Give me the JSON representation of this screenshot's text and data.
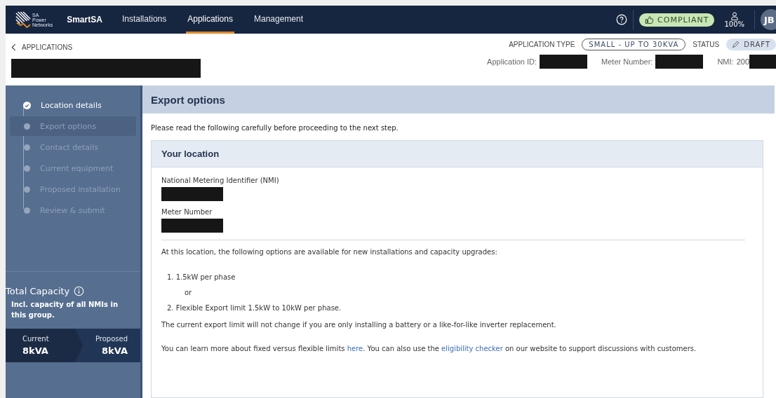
{
  "nav": {
    "logo_lines": [
      "SA",
      "Power",
      "Networks"
    ],
    "brand": "SmartSA",
    "tabs": [
      {
        "label": "Installations",
        "selected": false
      },
      {
        "label": "Applications",
        "selected": true
      },
      {
        "label": "Management",
        "selected": false
      }
    ],
    "compliance": "COMPLIANT",
    "zoom": "100%",
    "avatar": "JB"
  },
  "header": {
    "back": "APPLICATIONS",
    "type_label": "APPLICATION TYPE",
    "type_value": "SMALL - UP TO 30KVA",
    "status_label": "STATUS",
    "status_value": "DRAFT",
    "ids": [
      {
        "label": "Application ID:"
      },
      {
        "label": "Meter Number:"
      },
      {
        "label": "NMI:",
        "value": "200"
      }
    ]
  },
  "sidebar": {
    "steps": [
      {
        "label": "Location details",
        "completed": true,
        "selected": false
      },
      {
        "label": "Export options",
        "completed": false,
        "selected": true
      },
      {
        "label": "Contact details",
        "completed": false,
        "selected": false
      },
      {
        "label": "Current equipment",
        "completed": false,
        "selected": false
      },
      {
        "label": "Proposed installation",
        "completed": false,
        "selected": false
      },
      {
        "label": "Review & submit",
        "completed": false,
        "selected": false
      }
    ],
    "capacity": {
      "title": "Total Capacity",
      "note": "Incl. capacity of all NMIs in this group.",
      "current_label": "Current",
      "current_value": "8kVA",
      "proposed_label": "Proposed",
      "proposed_value": "8kVA"
    }
  },
  "content": {
    "title": "Export options",
    "intro": "Please read the following carefully before proceeding to the next step.",
    "card": {
      "title": "Your location",
      "fields": [
        {
          "label": "National Metering Identifier (NMI)"
        },
        {
          "label": "Meter Number"
        }
      ],
      "options_intro": "At this location, the following options are available for new installations and capacity upgrades:",
      "options": [
        "1. 1.5kW per phase",
        "2. Flexible Export limit 1.5kW to 10kW per phase."
      ],
      "separator": "or",
      "note": "The current export limit will not change if you are only installing a battery or a like-for-like inverter replacement.",
      "learn_more": [
        {
          "kind": "text",
          "text": "You can learn more about fixed versus flexible limits "
        },
        {
          "kind": "link",
          "text": "here"
        },
        {
          "kind": "text",
          "text": ". You can also use the "
        },
        {
          "kind": "link",
          "text": "eligibility checker"
        },
        {
          "kind": "text",
          "text": " on our website to support discussions with customers."
        }
      ]
    }
  }
}
